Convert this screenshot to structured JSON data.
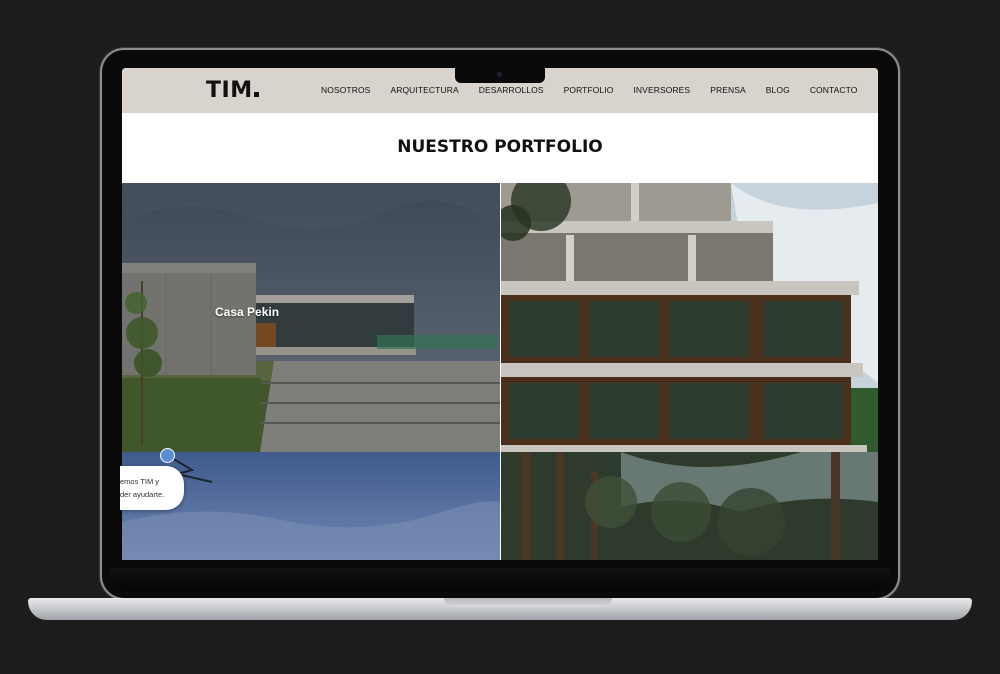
{
  "header": {
    "logo": "TIM",
    "nav": [
      "NOSOTROS",
      "ARQUITECTURA",
      "DESARROLLOS",
      "PORTFOLIO",
      "INVERSORES",
      "PRENSA",
      "BLOG",
      "CONTACTO"
    ]
  },
  "main": {
    "title": "NUESTRO PORTFOLIO",
    "tiles": [
      {
        "label": "Casa Pekin"
      }
    ]
  },
  "chat": {
    "line1": "emos TIM y",
    "line2": "der ayudarte."
  },
  "colors": {
    "header_bg": "#d8d3cc",
    "background": "#1c1c1c"
  }
}
